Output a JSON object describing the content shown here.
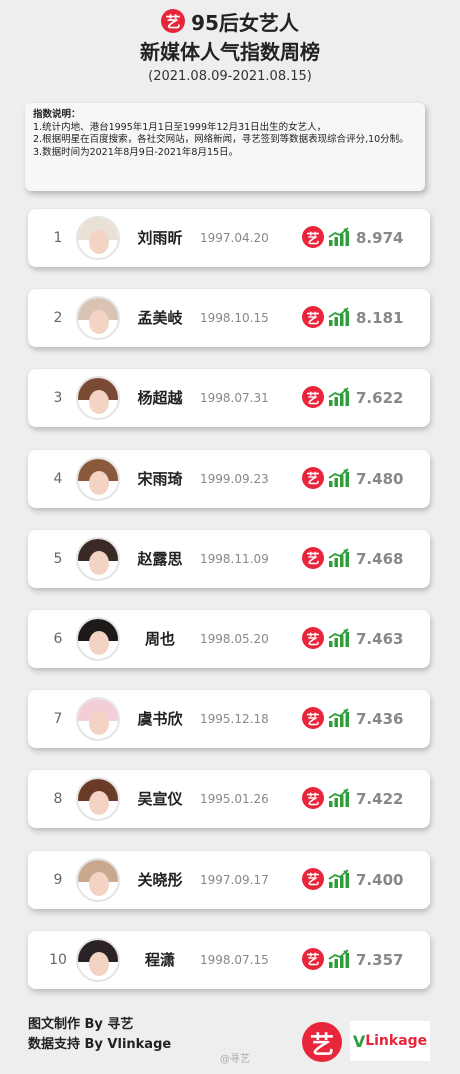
{
  "header": {
    "logo_char": "艺",
    "title_line1": "95后女艺人",
    "title_line2": "新媒体人气指数周榜",
    "date_range": "(2021.08.09-2021.08.15)"
  },
  "notes": {
    "title": "指数说明：",
    "line1": "1.统计内地、港台1995年1月1日至1999年12月31日出生的女艺人，",
    "line2": "2.根据明星在百度搜索，各社交网站，网络新闻，寻艺签到等数据表现综合评分,10分制。",
    "line3": "3.数据时间为2021年8月9日-2021年8月15日。"
  },
  "badge_char": "艺",
  "accent_red": "#e8253a",
  "trend_green": "#2e9d3a",
  "rankings": [
    {
      "rank": "1",
      "name": "刘雨昕",
      "birth": "1997.04.20",
      "score": "8.974",
      "hair": "#e9e1d6"
    },
    {
      "rank": "2",
      "name": "孟美岐",
      "birth": "1998.10.15",
      "score": "8.181",
      "hair": "#d9c3b2"
    },
    {
      "rank": "3",
      "name": "杨超越",
      "birth": "1998.07.31",
      "score": "7.622",
      "hair": "#7a4a34"
    },
    {
      "rank": "4",
      "name": "宋雨琦",
      "birth": "1999.09.23",
      "score": "7.480",
      "hair": "#8b5a3c"
    },
    {
      "rank": "5",
      "name": "赵露思",
      "birth": "1998.11.09",
      "score": "7.468",
      "hair": "#3a2a25"
    },
    {
      "rank": "6",
      "name": "周也",
      "birth": "1998.05.20",
      "score": "7.463",
      "hair": "#1e1a1a"
    },
    {
      "rank": "7",
      "name": "虞书欣",
      "birth": "1995.12.18",
      "score": "7.436",
      "hair": "#f2cfd6"
    },
    {
      "rank": "8",
      "name": "吴宣仪",
      "birth": "1995.01.26",
      "score": "7.422",
      "hair": "#6b3b2a"
    },
    {
      "rank": "9",
      "name": "关晓彤",
      "birth": "1997.09.17",
      "score": "7.400",
      "hair": "#caa88f"
    },
    {
      "rank": "10",
      "name": "程潇",
      "birth": "1998.07.15",
      "score": "7.357",
      "hair": "#2a2226"
    }
  ],
  "footer": {
    "made_by": "图文制作 By 寻艺",
    "data_by": "数据支持 By Vlinkage",
    "logo_char": "艺",
    "vlink_v": "V",
    "vlink_text": "Linkage",
    "watermark": "@寻艺"
  }
}
